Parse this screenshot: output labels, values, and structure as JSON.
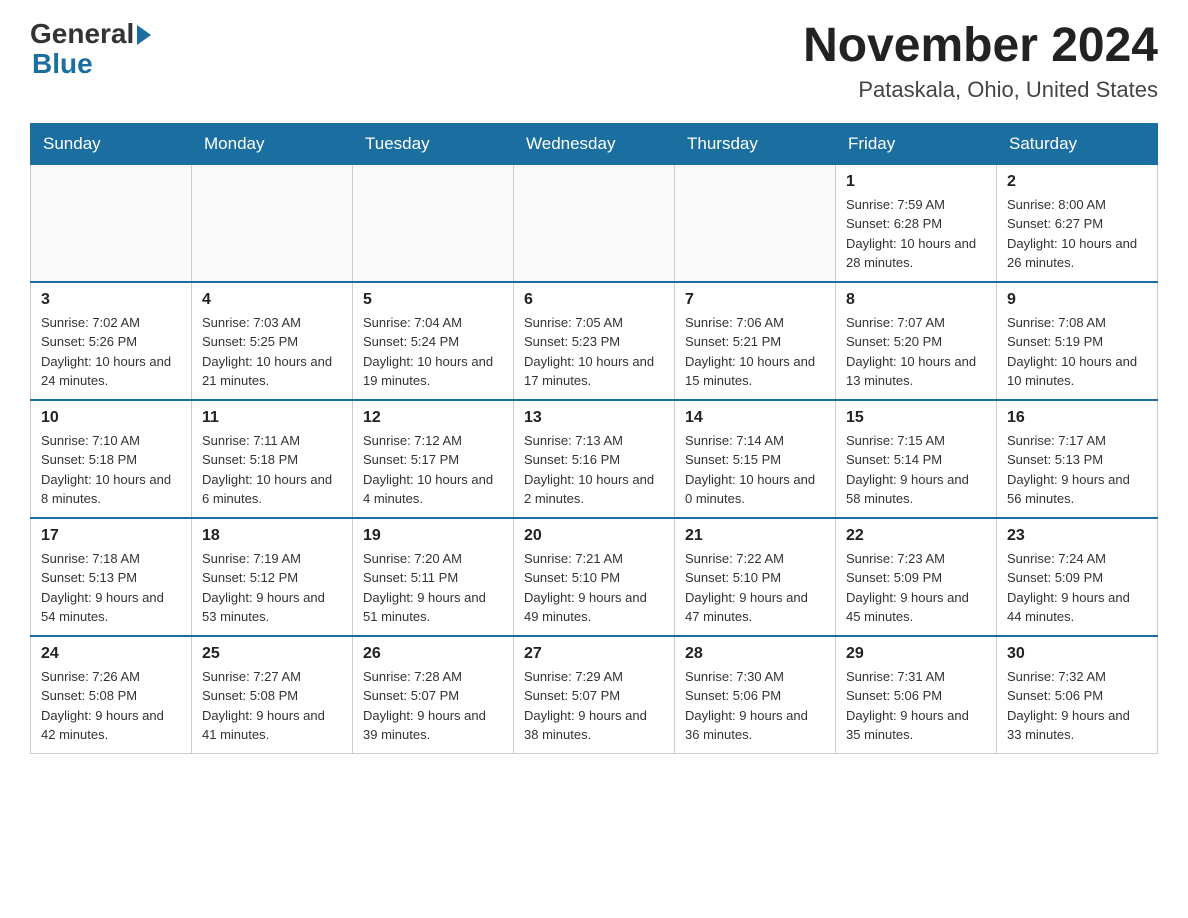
{
  "logo": {
    "general": "General",
    "blue": "Blue"
  },
  "title": "November 2024",
  "subtitle": "Pataskala, Ohio, United States",
  "days_of_week": [
    "Sunday",
    "Monday",
    "Tuesday",
    "Wednesday",
    "Thursday",
    "Friday",
    "Saturday"
  ],
  "weeks": [
    [
      {
        "day": "",
        "info": ""
      },
      {
        "day": "",
        "info": ""
      },
      {
        "day": "",
        "info": ""
      },
      {
        "day": "",
        "info": ""
      },
      {
        "day": "",
        "info": ""
      },
      {
        "day": "1",
        "info": "Sunrise: 7:59 AM\nSunset: 6:28 PM\nDaylight: 10 hours and 28 minutes."
      },
      {
        "day": "2",
        "info": "Sunrise: 8:00 AM\nSunset: 6:27 PM\nDaylight: 10 hours and 26 minutes."
      }
    ],
    [
      {
        "day": "3",
        "info": "Sunrise: 7:02 AM\nSunset: 5:26 PM\nDaylight: 10 hours and 24 minutes."
      },
      {
        "day": "4",
        "info": "Sunrise: 7:03 AM\nSunset: 5:25 PM\nDaylight: 10 hours and 21 minutes."
      },
      {
        "day": "5",
        "info": "Sunrise: 7:04 AM\nSunset: 5:24 PM\nDaylight: 10 hours and 19 minutes."
      },
      {
        "day": "6",
        "info": "Sunrise: 7:05 AM\nSunset: 5:23 PM\nDaylight: 10 hours and 17 minutes."
      },
      {
        "day": "7",
        "info": "Sunrise: 7:06 AM\nSunset: 5:21 PM\nDaylight: 10 hours and 15 minutes."
      },
      {
        "day": "8",
        "info": "Sunrise: 7:07 AM\nSunset: 5:20 PM\nDaylight: 10 hours and 13 minutes."
      },
      {
        "day": "9",
        "info": "Sunrise: 7:08 AM\nSunset: 5:19 PM\nDaylight: 10 hours and 10 minutes."
      }
    ],
    [
      {
        "day": "10",
        "info": "Sunrise: 7:10 AM\nSunset: 5:18 PM\nDaylight: 10 hours and 8 minutes."
      },
      {
        "day": "11",
        "info": "Sunrise: 7:11 AM\nSunset: 5:18 PM\nDaylight: 10 hours and 6 minutes."
      },
      {
        "day": "12",
        "info": "Sunrise: 7:12 AM\nSunset: 5:17 PM\nDaylight: 10 hours and 4 minutes."
      },
      {
        "day": "13",
        "info": "Sunrise: 7:13 AM\nSunset: 5:16 PM\nDaylight: 10 hours and 2 minutes."
      },
      {
        "day": "14",
        "info": "Sunrise: 7:14 AM\nSunset: 5:15 PM\nDaylight: 10 hours and 0 minutes."
      },
      {
        "day": "15",
        "info": "Sunrise: 7:15 AM\nSunset: 5:14 PM\nDaylight: 9 hours and 58 minutes."
      },
      {
        "day": "16",
        "info": "Sunrise: 7:17 AM\nSunset: 5:13 PM\nDaylight: 9 hours and 56 minutes."
      }
    ],
    [
      {
        "day": "17",
        "info": "Sunrise: 7:18 AM\nSunset: 5:13 PM\nDaylight: 9 hours and 54 minutes."
      },
      {
        "day": "18",
        "info": "Sunrise: 7:19 AM\nSunset: 5:12 PM\nDaylight: 9 hours and 53 minutes."
      },
      {
        "day": "19",
        "info": "Sunrise: 7:20 AM\nSunset: 5:11 PM\nDaylight: 9 hours and 51 minutes."
      },
      {
        "day": "20",
        "info": "Sunrise: 7:21 AM\nSunset: 5:10 PM\nDaylight: 9 hours and 49 minutes."
      },
      {
        "day": "21",
        "info": "Sunrise: 7:22 AM\nSunset: 5:10 PM\nDaylight: 9 hours and 47 minutes."
      },
      {
        "day": "22",
        "info": "Sunrise: 7:23 AM\nSunset: 5:09 PM\nDaylight: 9 hours and 45 minutes."
      },
      {
        "day": "23",
        "info": "Sunrise: 7:24 AM\nSunset: 5:09 PM\nDaylight: 9 hours and 44 minutes."
      }
    ],
    [
      {
        "day": "24",
        "info": "Sunrise: 7:26 AM\nSunset: 5:08 PM\nDaylight: 9 hours and 42 minutes."
      },
      {
        "day": "25",
        "info": "Sunrise: 7:27 AM\nSunset: 5:08 PM\nDaylight: 9 hours and 41 minutes."
      },
      {
        "day": "26",
        "info": "Sunrise: 7:28 AM\nSunset: 5:07 PM\nDaylight: 9 hours and 39 minutes."
      },
      {
        "day": "27",
        "info": "Sunrise: 7:29 AM\nSunset: 5:07 PM\nDaylight: 9 hours and 38 minutes."
      },
      {
        "day": "28",
        "info": "Sunrise: 7:30 AM\nSunset: 5:06 PM\nDaylight: 9 hours and 36 minutes."
      },
      {
        "day": "29",
        "info": "Sunrise: 7:31 AM\nSunset: 5:06 PM\nDaylight: 9 hours and 35 minutes."
      },
      {
        "day": "30",
        "info": "Sunrise: 7:32 AM\nSunset: 5:06 PM\nDaylight: 9 hours and 33 minutes."
      }
    ]
  ]
}
